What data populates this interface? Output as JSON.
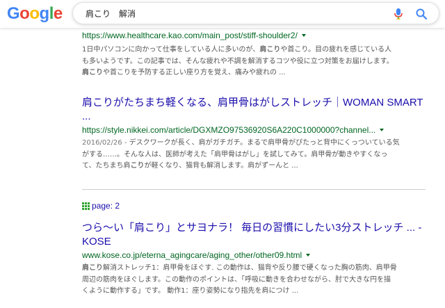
{
  "header": {
    "logo": [
      "G",
      "o",
      "o",
      "g",
      "l",
      "e"
    ],
    "logo_colors": [
      "#4285f4",
      "#ea4335",
      "#fbbc05",
      "#4285f4",
      "#34a853",
      "#ea4335"
    ],
    "query": "肩こり　解消"
  },
  "results": [
    {
      "url": "https://www.healthcare.kao.com/main_post/stiff-shoulder2/",
      "lines": [
        [
          "1日中パソコンに向かって仕事をしている人に多いのが、",
          "肩こり",
          "や首こり。目の疲れを感じている人"
        ],
        [
          "も多いようです。この記事では、そんな疲れや不調を解消するコツや役に立つ対策をお届けします。"
        ],
        [
          "",
          "肩こり",
          "や首こりを予防する正しい座り方を覚え、痛みや疲れの ..."
        ]
      ]
    },
    {
      "title_line1": "肩こりがたちまち軽くなる、肩甲骨はがしストレッチ｜WOMAN SMART",
      "title_line2": "...",
      "url": "https://style.nikkei.com/article/DGXMZO97536920S6A220C1000000?channel...",
      "date": "2016/02/26 - ",
      "lines": [
        [
          "デスクワークが長く、肩がガチガチ。まるで肩甲骨がぴたっと背中にくっついている気"
        ],
        [
          "がする……。そんな人は、医師が考えた「肩甲骨はがし」を試してみて。肩甲骨が動きやすくなっ"
        ],
        [
          "て、たちまち肩",
          "こり",
          "が軽くなり、猫背も解消します。肩がずーんと ..."
        ]
      ]
    },
    {
      "title_line1": "つら～い「肩こり」とサヨナラ！ 毎日の習慣にしたい3分ストレッチ ... -",
      "title_line2": "KOSE",
      "url": "www.kose.co.jp/eterna_agingcare/aging_other/other09.html",
      "lines": [
        [
          "",
          "肩こり",
          "解消ストレッチ1：肩甲骨をほぐす. この動作は、猫背や反り腰で硬くなった胸の筋肉、肩甲骨"
        ],
        [
          "周辺の筋肉をほぐします。この動作のポイントは、「呼吸に動きを合わせながら、肘で大きな円を描"
        ],
        [
          "くように動作する」です。 動作1：座り姿勢になり指先を肩につけ ..."
        ]
      ]
    }
  ],
  "page_marker": {
    "label": "page: 2"
  }
}
